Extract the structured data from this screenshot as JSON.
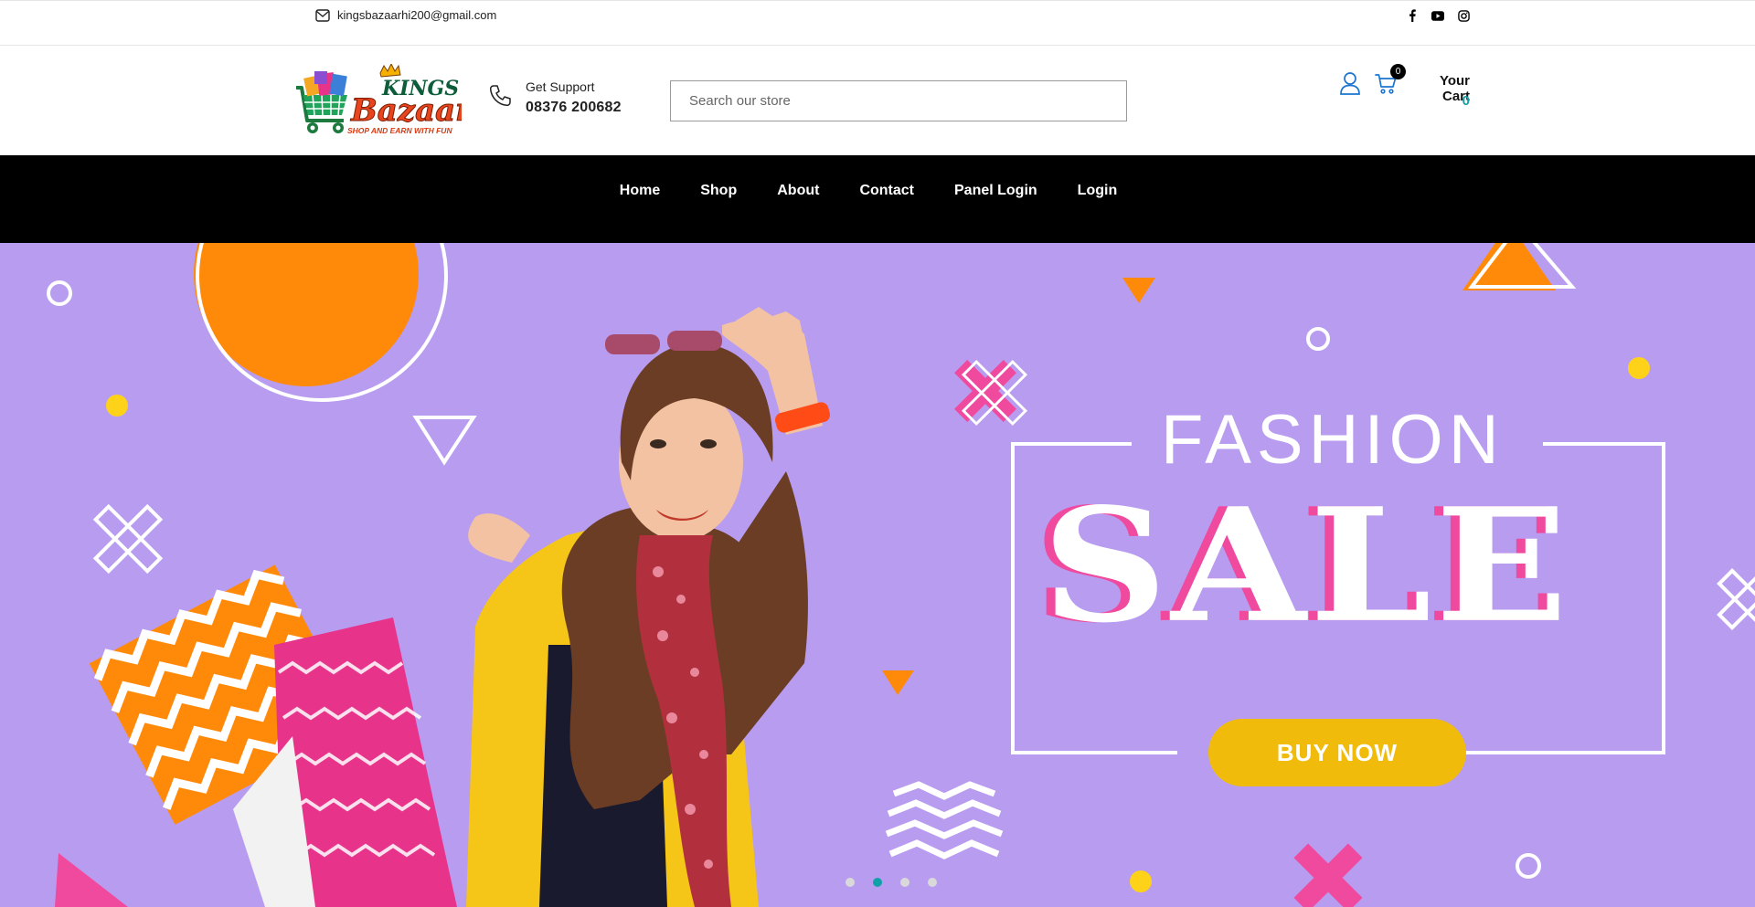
{
  "topbar": {
    "email": "kingsbazaarhi200@gmail.com",
    "social_icons": [
      "facebook-icon",
      "youtube-icon",
      "instagram-icon"
    ]
  },
  "header": {
    "logo": {
      "line1": "KINGS",
      "line2": "Bazaar",
      "tagline": "SHOP AND EARN WITH FUN"
    },
    "support": {
      "label": "Get Support",
      "phone": "08376 200682"
    },
    "search": {
      "placeholder": "Search our store",
      "value": ""
    },
    "cart": {
      "badge": "0",
      "label": "Your Cart",
      "total": "0"
    }
  },
  "nav": {
    "items": [
      {
        "label": "Home"
      },
      {
        "label": "Shop"
      },
      {
        "label": "About"
      },
      {
        "label": "Contact"
      },
      {
        "label": "Panel Login"
      },
      {
        "label": "Login"
      }
    ]
  },
  "hero": {
    "headline_top": "FASHION",
    "headline_main": "SALE",
    "cta": "BUY NOW",
    "slide_count": 4,
    "active_slide": 2
  },
  "colors": {
    "accent_teal": "#12a0a8",
    "hero_bg": "#b89cf0",
    "nav_bg": "#000000",
    "cta_yellow": "#f0bb0a",
    "pink": "#f04a9f",
    "orange": "#ff8a0a"
  }
}
